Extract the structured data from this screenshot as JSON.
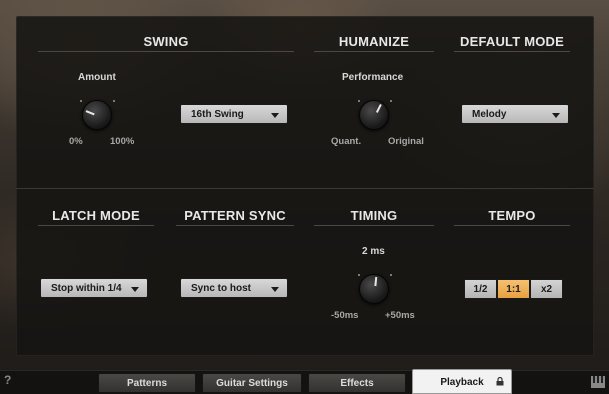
{
  "sections": {
    "swing": "SWING",
    "humanize": "HUMANIZE",
    "default_mode": "DEFAULT MODE",
    "latch_mode": "LATCH MODE",
    "pattern_sync": "PATTERN SYNC",
    "timing": "TIMING",
    "tempo": "TEMPO"
  },
  "swing": {
    "amount_label": "Amount",
    "min_label": "0%",
    "max_label": "100%",
    "amount_value": 0.25,
    "dropdown_value": "16th Swing"
  },
  "humanize": {
    "performance_label": "Performance",
    "min_label": "Quant.",
    "max_label": "Original",
    "performance_value": 0.6
  },
  "default_mode": {
    "dropdown_value": "Melody"
  },
  "latch_mode": {
    "dropdown_value": "Stop within 1/4"
  },
  "pattern_sync": {
    "dropdown_value": "Sync to host"
  },
  "timing": {
    "value_label": "2 ms",
    "min_label": "-50ms",
    "max_label": "+50ms",
    "value": 0.52
  },
  "tempo": {
    "buttons": [
      "1/2",
      "1:1",
      "x2"
    ],
    "selected": "1:1"
  },
  "footer": {
    "help": "?",
    "tabs": [
      "Patterns",
      "Guitar Settings",
      "Effects",
      "Playback"
    ],
    "active_tab": "Playback"
  },
  "colors": {
    "accent": "#f0b460",
    "panel": "#161412"
  },
  "icons": {
    "help": "question-mark-icon",
    "lock": "lock-icon",
    "keyboard": "keyboard-icon"
  }
}
